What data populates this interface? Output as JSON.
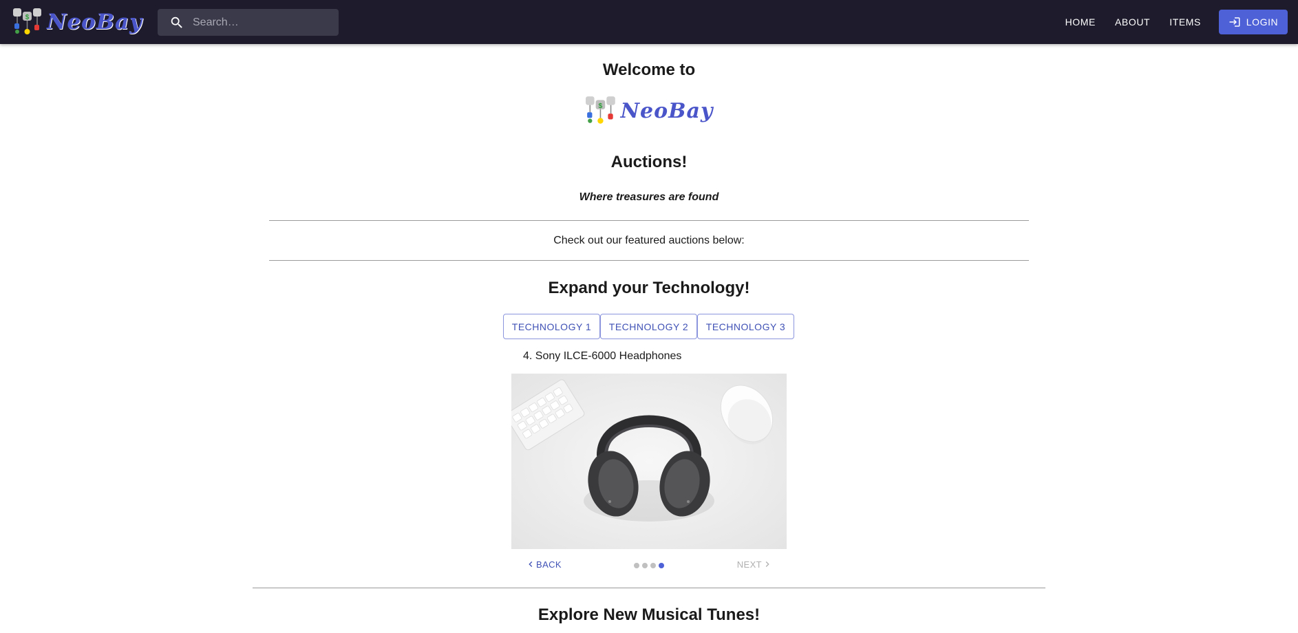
{
  "header": {
    "logo_text": "NeoBay",
    "search_placeholder": "Search…",
    "nav": {
      "home": "HOME",
      "about": "ABOUT",
      "items": "ITEMS",
      "login": "LOGIN"
    }
  },
  "hero": {
    "welcome": "Welcome to",
    "logo_text": "NeoBay",
    "subtitle": "Auctions!",
    "tagline": "Where treasures are found"
  },
  "featured_text": "Check out our featured auctions below:",
  "technology": {
    "heading": "Expand your Technology!",
    "tabs": [
      "TECHNOLOGY 1",
      "TECHNOLOGY 2",
      "TECHNOLOGY 3"
    ],
    "step_label": "4. Sony ILCE-6000 Headphones",
    "back_label": "BACK",
    "next_label": "NEXT",
    "active_step": 4,
    "total_steps": 4
  },
  "music": {
    "heading": "Explore New Musical Tunes!"
  },
  "icons": [
    "search-icon",
    "login-icon",
    "chevron-left-icon",
    "chevron-right-icon"
  ],
  "colors": {
    "appbar": "#1e1c2c",
    "accent": "#4e61d6",
    "brand": "#4a55c9"
  }
}
